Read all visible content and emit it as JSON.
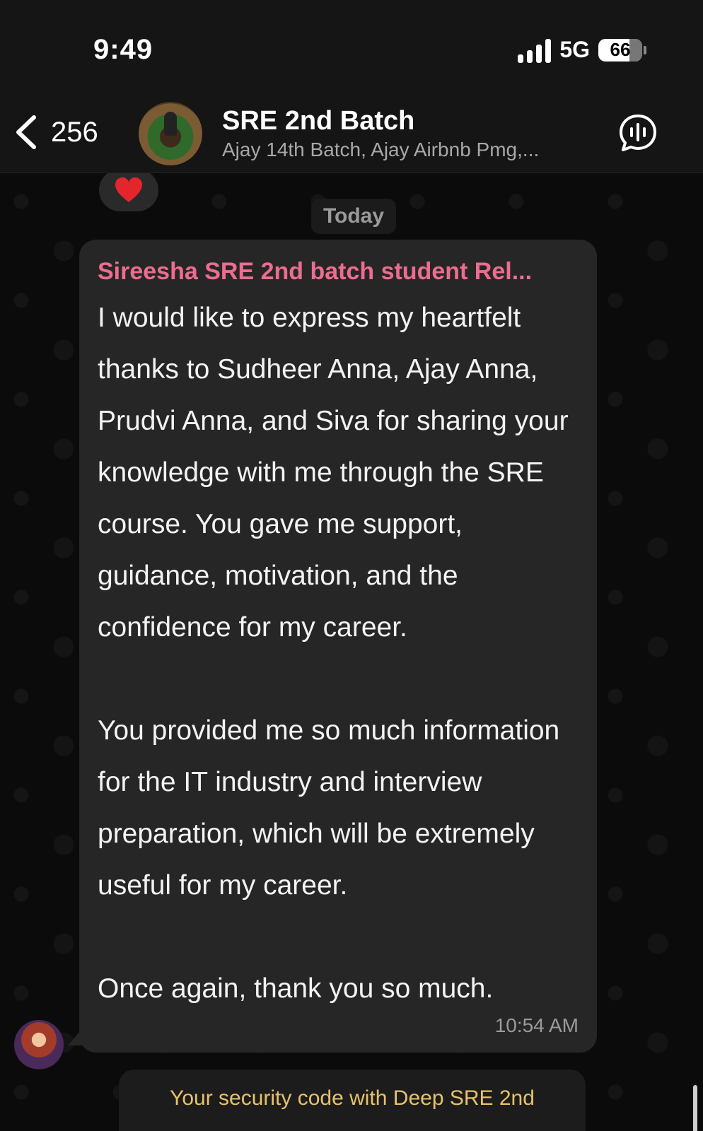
{
  "status_bar": {
    "time": "9:49",
    "network": "5G",
    "battery": "66"
  },
  "header": {
    "back_count": "256",
    "title": "SRE 2nd Batch",
    "subtitle": "Ajay 14th Batch, Ajay Airbnb Pmg,..."
  },
  "chat": {
    "date_label": "Today",
    "message": {
      "sender": "Sireesha SRE 2nd batch student Rel...",
      "paragraphs": [
        "I would like to express my heartfelt thanks to Sudheer Anna, Ajay Anna, Prudvi Anna, and Siva for sharing your knowledge with me through the SRE course. You gave me support, guidance, motivation, and the confidence for my career.",
        "You provided me so much information for the IT industry and interview preparation, which will be extremely useful for my career.",
        "Once again, thank you so much."
      ],
      "time": "10:54 AM"
    },
    "system_notice": "Your security code with Deep SRE 2nd"
  },
  "icons": {
    "back": "chevron-left-icon",
    "voice": "voice-chat-icon",
    "reaction": "heart-icon"
  },
  "colors": {
    "sender_name": "#ec6d8f",
    "bubble": "#262626",
    "notice_text": "#e7c26a"
  }
}
